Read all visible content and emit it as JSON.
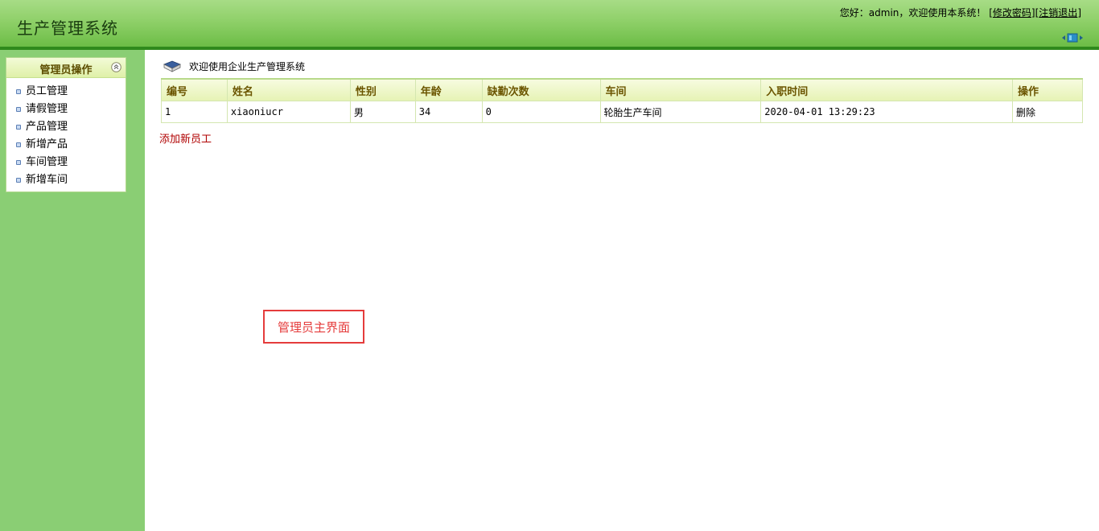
{
  "header": {
    "app_title": "生产管理系统",
    "greeting": "您好：admin，欢迎使用本系统！",
    "bracket_open": "[",
    "bracket_mid": "][",
    "bracket_close": "]",
    "change_password": "修改密码",
    "logout": "注销退出",
    "toggle_icon": "sidebar-toggle-icon"
  },
  "sidebar": {
    "title": "管理员操作",
    "collapse_icon": "collapse-up-icon",
    "items": [
      {
        "label": "员工管理"
      },
      {
        "label": "请假管理"
      },
      {
        "label": "产品管理"
      },
      {
        "label": "新增产品"
      },
      {
        "label": "车间管理"
      },
      {
        "label": "新增车间"
      }
    ]
  },
  "main": {
    "welcome_icon": "book-icon",
    "welcome_text": "欢迎使用企业生产管理系统",
    "table": {
      "headers": [
        "编号",
        "姓名",
        "性别",
        "年龄",
        "缺勤次数",
        "车间",
        "入职时间",
        "操作"
      ],
      "rows": [
        [
          "1",
          "xiaoniucr",
          "男",
          "34",
          "0",
          "轮胎生产车间",
          "2020-04-01 13:29:23",
          "删除"
        ]
      ]
    },
    "add_link": "添加新员工",
    "annotation": "管理员主界面"
  },
  "colors": {
    "header_green": "#8fd069",
    "header_line": "#2f8a1c",
    "sidebar_green": "#8ace74",
    "table_header_text": "#6b5500",
    "link_red": "#b00000",
    "annotation_red": "#e53c3c"
  }
}
